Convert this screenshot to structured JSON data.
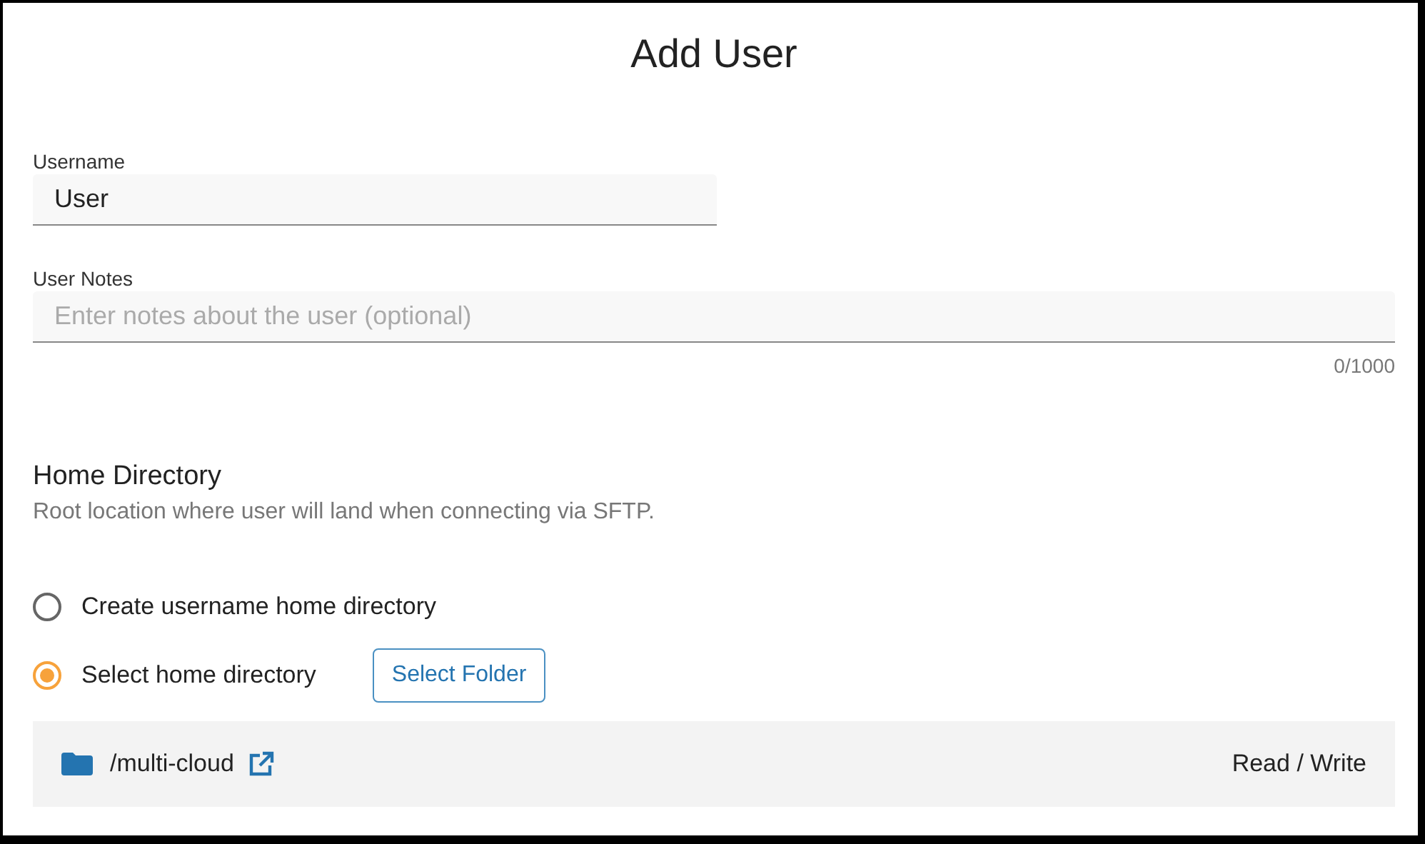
{
  "title": "Add User",
  "username": {
    "label": "Username",
    "value": "User"
  },
  "notes": {
    "label": "User Notes",
    "placeholder": "Enter notes about the user (optional)",
    "counter": "0/1000"
  },
  "home_directory": {
    "heading": "Home Directory",
    "description": "Root location where user will land when connecting via SFTP.",
    "options": [
      {
        "label": "Create username home directory",
        "selected": false
      },
      {
        "label": "Select home directory",
        "selected": true
      }
    ],
    "select_button": "Select Folder",
    "folder": {
      "path": "/multi-cloud",
      "permission": "Read / Write"
    }
  }
}
